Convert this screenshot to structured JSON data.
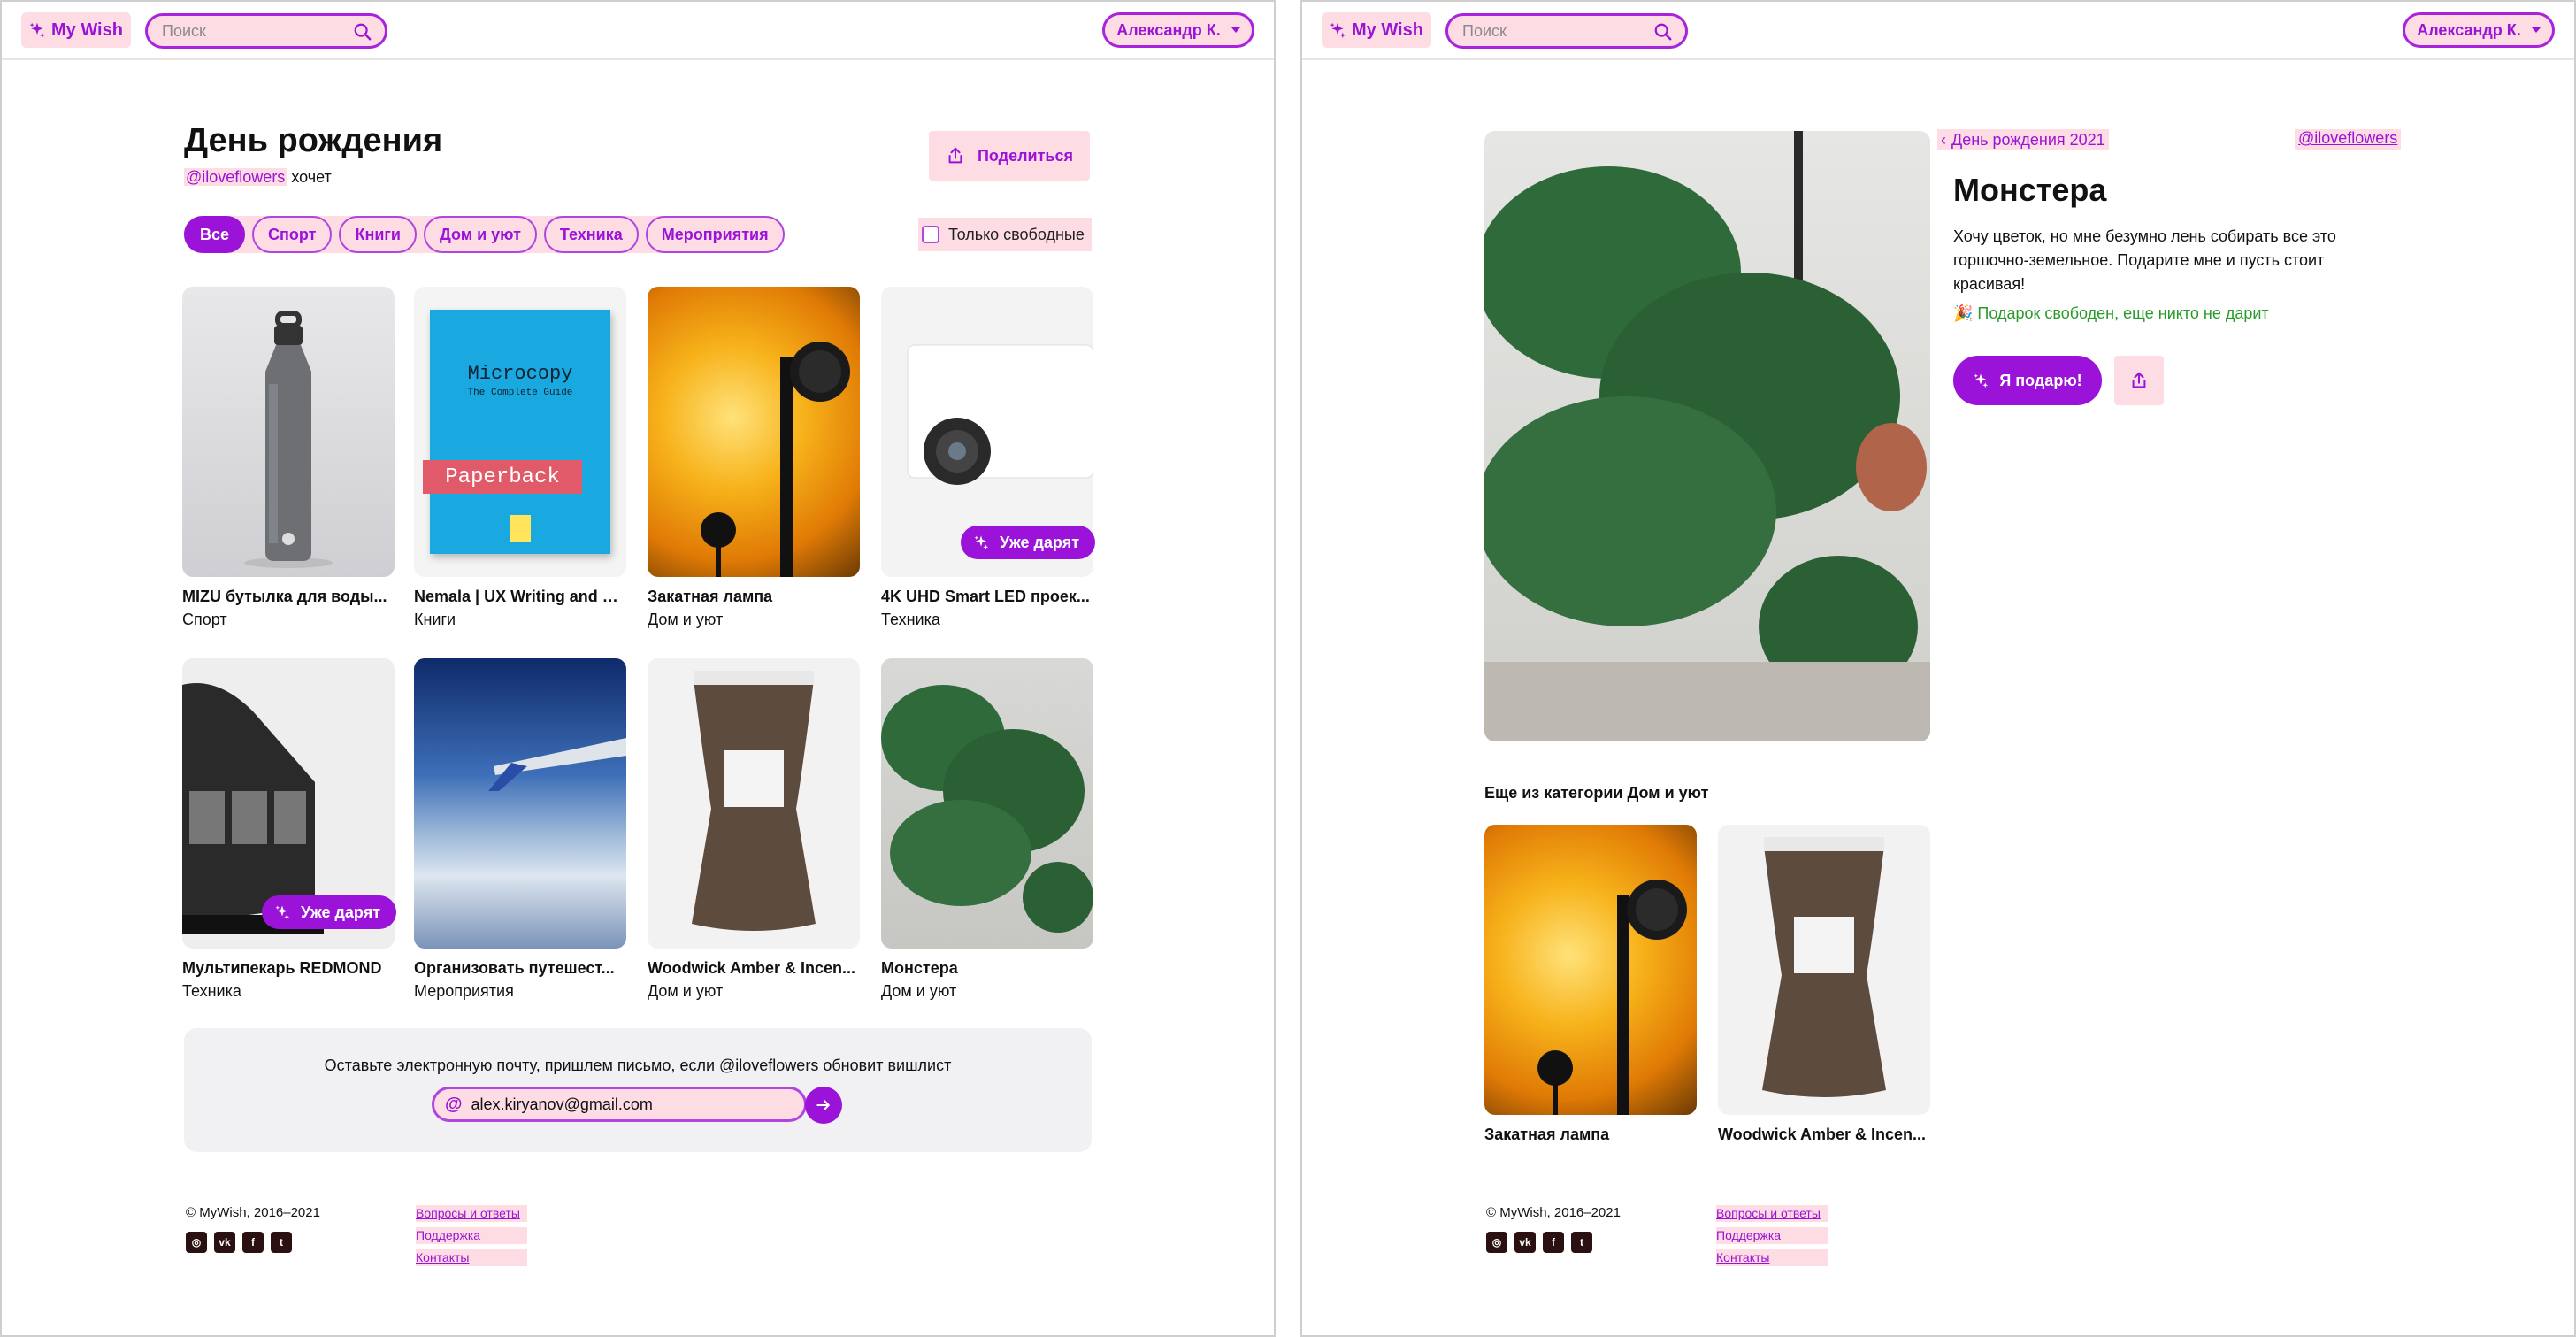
{
  "app": {
    "logo": "My Wish",
    "search_placeholder": "Поиск",
    "user": "Александр К."
  },
  "list": {
    "title": "День рождения",
    "owner": "@iloveflowers",
    "wants": "хочет",
    "share": "Поделиться",
    "categories": [
      "Все",
      "Спорт",
      "Книги",
      "Дом и уют",
      "Техника",
      "Мероприятия"
    ],
    "only_free": "Только свободные",
    "items": [
      {
        "name": "MIZU бутылка для воды...",
        "category": "Спорт"
      },
      {
        "name": "Nemala | UX Writing and M...",
        "category": "Книги"
      },
      {
        "name": "Закатная лампа",
        "category": "Дом и уют"
      },
      {
        "name": "4K UHD Smart LED проек...",
        "category": "Техника",
        "badge": "Уже дарят"
      },
      {
        "name": "Мультипекарь REDMOND",
        "category": "Техника",
        "badge": "Уже дарят"
      },
      {
        "name": "Организовать путешест...",
        "category": "Мероприятия"
      },
      {
        "name": "Woodwick Amber & Incen...",
        "category": "Дом и уют"
      },
      {
        "name": "Монстера",
        "category": "Дом и уют"
      }
    ],
    "book": {
      "title": "Microcopy",
      "subtitle": "The Complete Guide",
      "tag": "Paperback"
    },
    "subscribe_text": "Оставьте электронную почту, пришлем письмо, если @iloveflowers обновит вишлист",
    "email": "alex.kiryanov@gmail.com"
  },
  "detail": {
    "back": "День рождения 2021",
    "owner": "@iloveflowers",
    "title": "Монстера",
    "description": "Хочу цветок, но мне безумно лень собирать все это горшочно-земельное. Подарите мне и пусть стоит красивая!",
    "status": "🎉 Подарок свободен, еще никто не дарит",
    "give": "Я подарю!",
    "more_title": "Еще из категории Дом и уют",
    "more_items": [
      {
        "name": "Закатная лампа"
      },
      {
        "name": "Woodwick Amber & Incen..."
      }
    ]
  },
  "footer": {
    "copyright": "© MyWish, 2016–2021",
    "links": [
      "Вопросы и ответы",
      "Поддержка",
      "Контакты"
    ],
    "socials": [
      "instagram-icon",
      "vk-icon",
      "facebook-icon",
      "twitter-icon"
    ]
  },
  "colors": {
    "accent": "#9b12d8",
    "highlight": "#fddde3",
    "free": "#2a9a2a"
  }
}
